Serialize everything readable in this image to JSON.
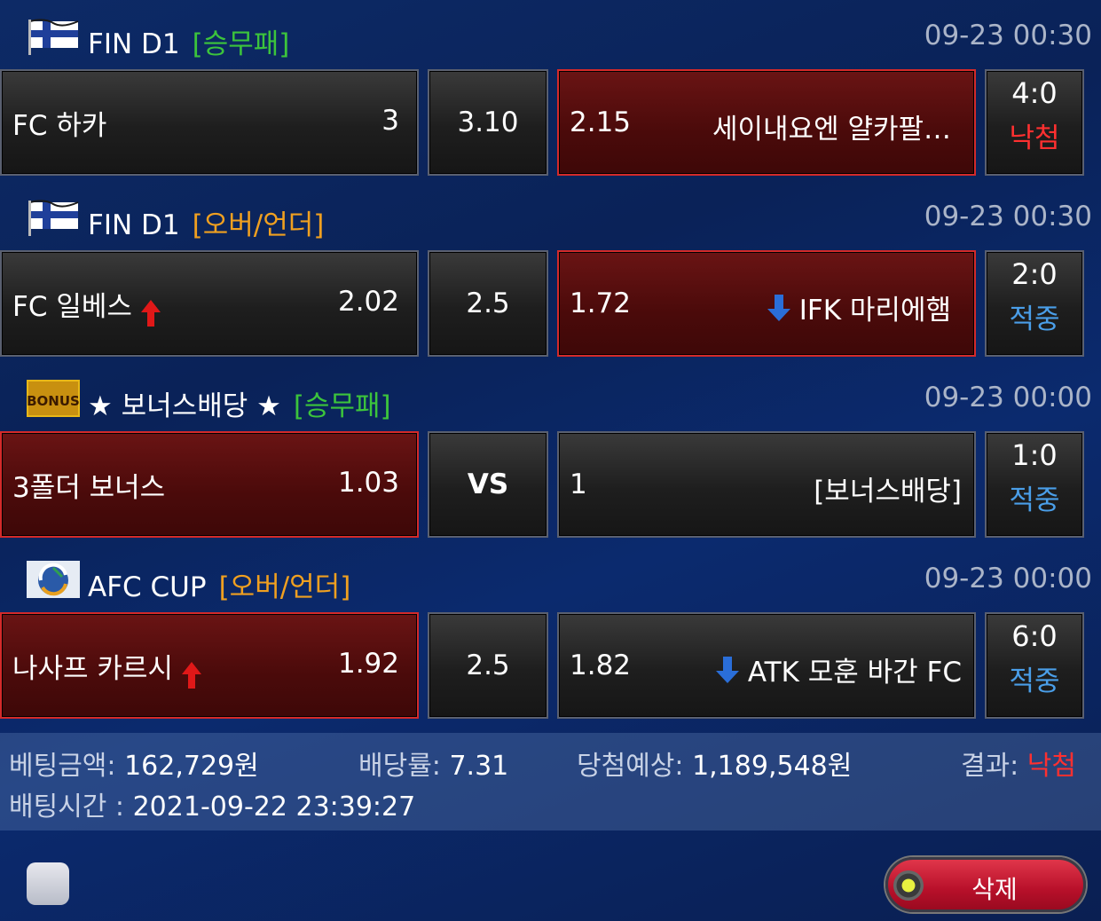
{
  "matches": [
    {
      "league": "FIN D1",
      "bet_type": "[승무패]",
      "time": "09-23 00:30",
      "home_name": "FC 하카",
      "home_odd": "3",
      "middle": "3.10",
      "away_odd": "2.15",
      "away_name": "세이내요엔 얄카팔…",
      "score": "4:0",
      "status": "낙첨"
    },
    {
      "league": "FIN D1",
      "bet_type": "[오버/언더]",
      "time": "09-23 00:30",
      "home_name": "FC 일베스",
      "home_odd": "2.02",
      "middle": "2.5",
      "away_odd": "1.72",
      "away_name": "IFK 마리에햄",
      "score": "2:0",
      "status": "적중"
    },
    {
      "league": "★ 보너스배당 ★",
      "bet_type": "[승무패]",
      "time": "09-23 00:00",
      "home_name": "3폴더 보너스",
      "home_odd": "1.03",
      "middle": "VS",
      "away_odd": "1",
      "away_name": "[보너스배당]",
      "score": "1:0",
      "status": "적중",
      "badge_text": "BONUS"
    },
    {
      "league": "AFC CUP",
      "bet_type": "[오버/언더]",
      "time": "09-23 00:00",
      "home_name": "나사프 카르시",
      "home_odd": "1.92",
      "middle": "2.5",
      "away_odd": "1.82",
      "away_name": "ATK 모훈 바간 FC",
      "score": "6:0",
      "status": "적중"
    }
  ],
  "summary": {
    "bet_amount_label": "베팅금액:",
    "bet_amount": "162,729원",
    "odds_label": "배당률:",
    "odds": "7.31",
    "expected_label": "당첨예상:",
    "expected": "1,189,548원",
    "result_label": "결과:",
    "result": "낙첨",
    "time_label": "배팅시간 :",
    "time": "2021-09-22 23:39:27"
  },
  "delete_label": "삭제",
  "colors": {
    "selected_red": "#4a0a0a",
    "win_blue": "#4a9ee8",
    "lose_red": "#ff3030",
    "type_green": "#3cc43c",
    "type_orange": "#f0a020"
  }
}
